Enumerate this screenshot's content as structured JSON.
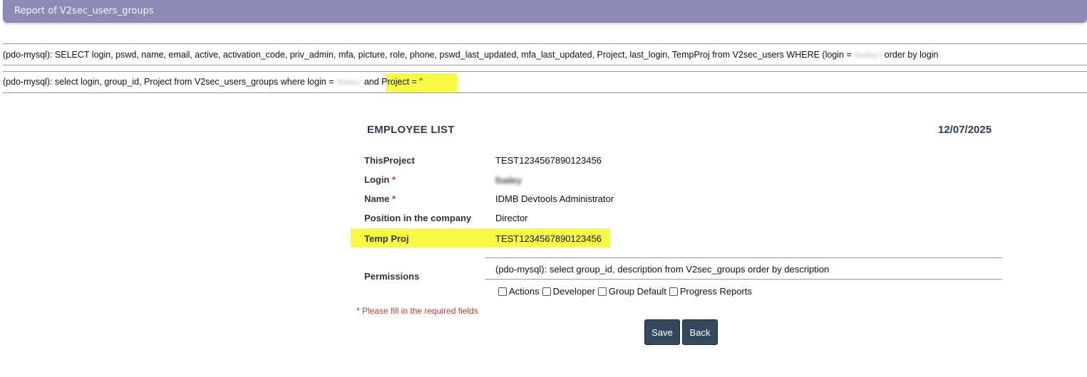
{
  "window": {
    "title": "Report of V2sec_users_groups"
  },
  "queries": {
    "q1_prefix": "(pdo-mysql): SELECT login, pswd, name, email, active, activation_code, priv_admin, mfa, picture, role, phone, pswd_last_updated, mfa_last_updated, Project, last_login, TempProj from V2sec_users WHERE (login = ",
    "q1_blurred": "'lbailey')",
    "q1_suffix": " order by login",
    "q2_prefix": "(pdo-mysql): select login, group_id, Project from V2sec_users_groups where login = ",
    "q2_blurred": "'lbailey'",
    "q2_and": " and Project = ''"
  },
  "form": {
    "heading": "EMPLOYEE LIST",
    "date": "12/07/2025",
    "fields": [
      {
        "label": "ThisProject",
        "required": "",
        "value": "TEST1234567890123456"
      },
      {
        "label": "Login",
        "required": " *",
        "value": "lbailey"
      },
      {
        "label": "Name",
        "required": " *",
        "value": "IDMB Devtools Administrator"
      },
      {
        "label": "Position in the company",
        "required": "",
        "value": "Director"
      },
      {
        "label": "Temp Proj",
        "required": "",
        "value": "TEST1234567890123456"
      }
    ],
    "permissions_label": "Permissions",
    "permissions_query": "(pdo-mysql): select group_id, description from V2sec_groups order by description",
    "permission_options": [
      {
        "label": "Actions",
        "checked": false
      },
      {
        "label": "Developer",
        "checked": false
      },
      {
        "label": "Group Default",
        "checked": false
      },
      {
        "label": "Progress Reports",
        "checked": false
      }
    ],
    "required_note": "* Please fill in the required fields",
    "save_label": "Save",
    "back_label": "Back"
  },
  "colors": {
    "title_bar": "#8c8bb8",
    "highlight": "#f7f942",
    "button": "#34495e",
    "required": "#c0392b"
  }
}
